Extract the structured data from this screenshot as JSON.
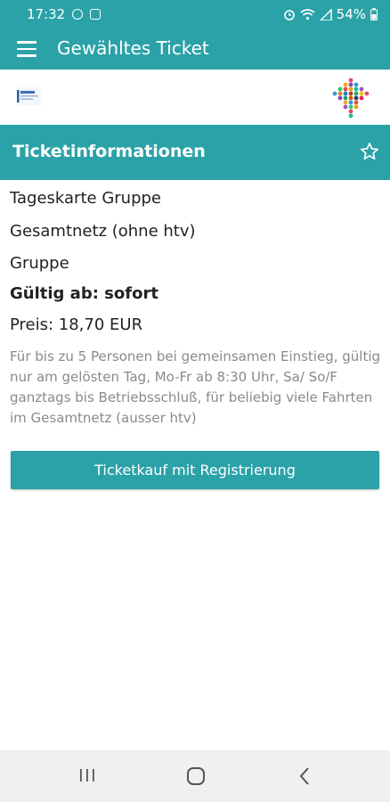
{
  "status_bar": {
    "time": "17:32",
    "battery": "54%",
    "icons": [
      "notification-icon",
      "gallery-icon",
      "alarm-icon",
      "wifi-icon",
      "signal-icon",
      "battery-icon"
    ]
  },
  "app_bar": {
    "title": "Gewähltes Ticket",
    "menu_icon": "hamburger-menu-icon"
  },
  "section": {
    "title": "Ticketinformationen",
    "favorite_icon": "star-outline-icon"
  },
  "ticket": {
    "name": "Tageskarte Gruppe",
    "network": "Gesamtnetz (ohne htv)",
    "category": "Gruppe",
    "valid_from": "Gültig ab: sofort",
    "price": "Preis: 18,70 EUR",
    "description": "Für bis zu 5 Personen bei gemeinsamen Einstieg, gültig nur am gelösten Tag, Mo-Fr ab 8:30 Uhr, Sa/ So/F ganztags bis Betriebsschluß, für beliebig viele Fahrten im Gesamtnetz (ausser htv)"
  },
  "actions": {
    "buy_label": "Ticketkauf mit Registrierung"
  },
  "colors": {
    "accent": "#2aa2a7",
    "description_text": "#8a8a8a",
    "nav_bar": "#f0f0f0"
  }
}
